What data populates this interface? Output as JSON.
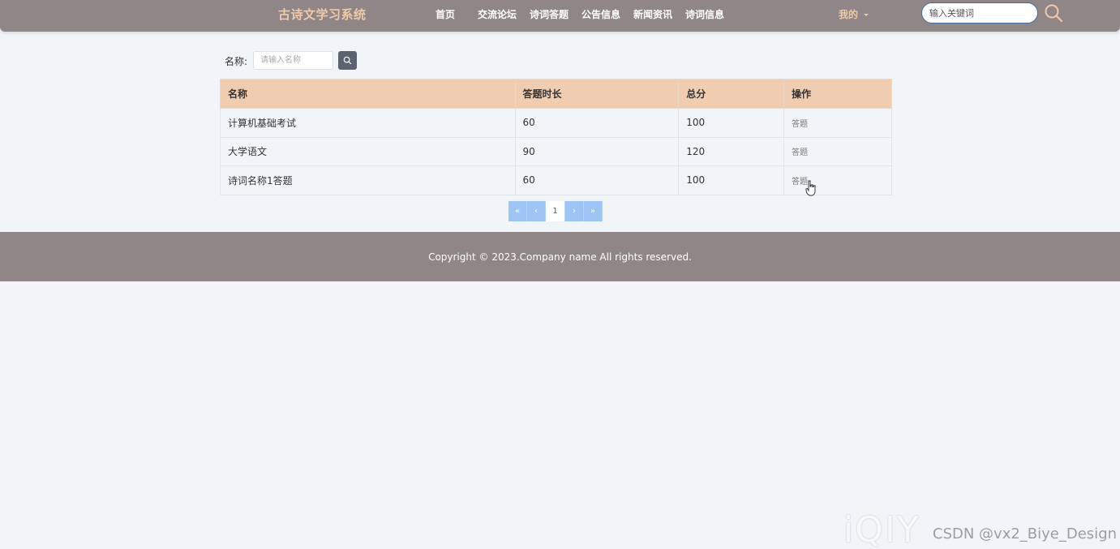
{
  "header": {
    "brand": "古诗文学习系统",
    "nav": [
      "首页",
      "交流论坛",
      "诗词答题",
      "公告信息",
      "新闻资讯",
      "诗词信息"
    ],
    "mine": "我的",
    "search_placeholder": "输入关键词"
  },
  "filter": {
    "label": "名称:",
    "placeholder": "请输入名称"
  },
  "table": {
    "columns": [
      "名称",
      "答题时长",
      "总分",
      "操作"
    ],
    "rows": [
      {
        "name": "计算机基础考试",
        "duration": "60",
        "score": "100",
        "action": "答题"
      },
      {
        "name": "大学语文",
        "duration": "90",
        "score": "120",
        "action": "答题"
      },
      {
        "name": "诗词名称1答题",
        "duration": "60",
        "score": "100",
        "action": "答题"
      }
    ]
  },
  "pager": {
    "first": "«",
    "prev": "‹",
    "current": "1",
    "next": "›",
    "last": "»"
  },
  "footer": {
    "copyright": "Copyright © 2023.Company name All rights reserved."
  },
  "watermark": {
    "logo": "iQIY",
    "text": "CSDN @vx2_Biye_Design"
  },
  "colors": {
    "header_bg": "#918687",
    "brand": "#f0c9a7",
    "table_header_bg": "#f0cdb0",
    "pager_bg": "#9ec3f5",
    "filter_btn_bg": "#5b6370"
  }
}
